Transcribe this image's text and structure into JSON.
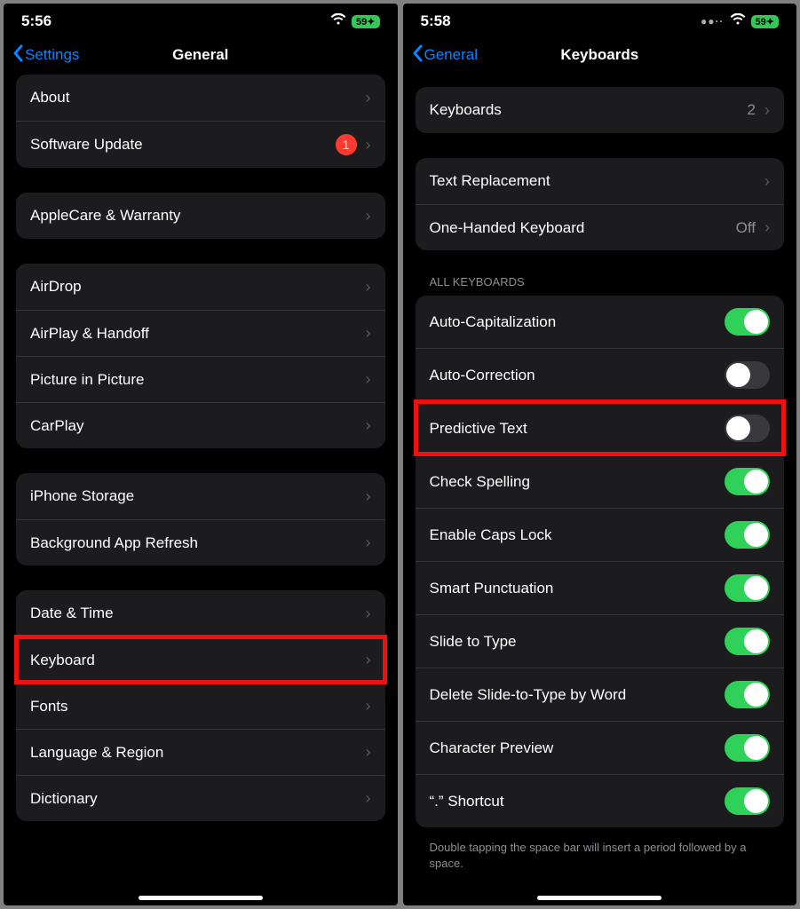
{
  "left": {
    "status": {
      "time": "5:56",
      "battery": "59"
    },
    "nav": {
      "back": "Settings",
      "title": "General"
    },
    "group1": {
      "about": "About",
      "software_update": "Software Update",
      "software_update_badge": "1"
    },
    "group2": {
      "applecare": "AppleCare & Warranty"
    },
    "group3": {
      "airdrop": "AirDrop",
      "airplay": "AirPlay & Handoff",
      "pip": "Picture in Picture",
      "carplay": "CarPlay"
    },
    "group4": {
      "storage": "iPhone Storage",
      "bg_refresh": "Background App Refresh"
    },
    "group5": {
      "datetime": "Date & Time",
      "keyboard": "Keyboard",
      "fonts": "Fonts",
      "language": "Language & Region",
      "dictionary": "Dictionary"
    }
  },
  "right": {
    "status": {
      "time": "5:58",
      "battery": "59"
    },
    "nav": {
      "back": "General",
      "title": "Keyboards"
    },
    "group1": {
      "keyboards": "Keyboards",
      "keyboards_count": "2"
    },
    "group2": {
      "text_replacement": "Text Replacement",
      "one_handed": "One-Handed Keyboard",
      "one_handed_value": "Off"
    },
    "group3_header": "All Keyboards",
    "group3": {
      "auto_cap": "Auto-Capitalization",
      "auto_corr": "Auto-Correction",
      "predictive": "Predictive Text",
      "check_spell": "Check Spelling",
      "caps_lock": "Enable Caps Lock",
      "smart_punct": "Smart Punctuation",
      "slide": "Slide to Type",
      "delete_slide": "Delete Slide-to-Type by Word",
      "char_preview": "Character Preview",
      "shortcut": "“.” Shortcut"
    },
    "footer": "Double tapping the space bar will insert a period followed by a space."
  }
}
